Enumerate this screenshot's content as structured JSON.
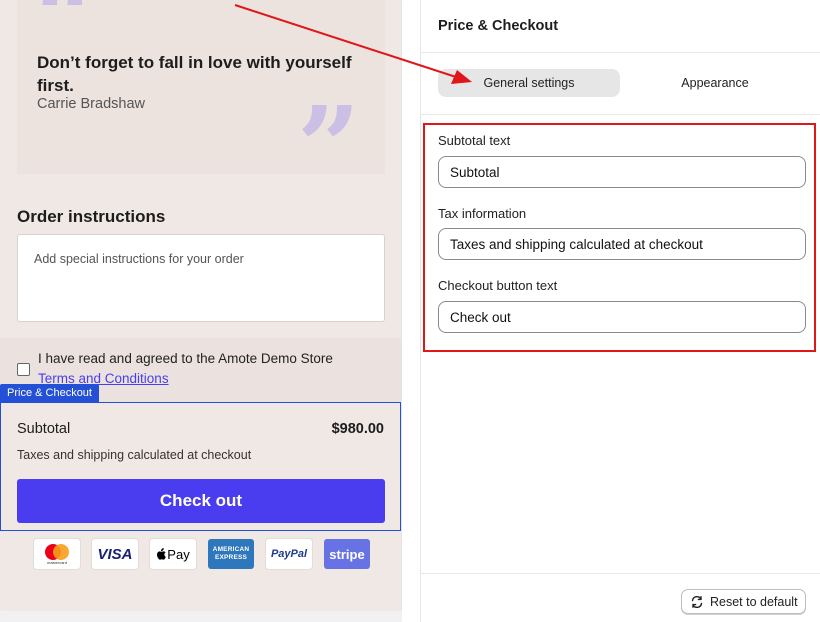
{
  "preview": {
    "quote": {
      "open_mark": "“",
      "close_mark": "”",
      "text": "Don’t forget to fall in love with yourself first.",
      "author": "Carrie Bradshaw"
    },
    "order_instructions": {
      "title": "Order instructions",
      "placeholder": "Add special instructions for your order"
    },
    "terms": {
      "text": "I have read and agreed to the Amote Demo Store",
      "link": "Terms and Conditions",
      "checked": false
    },
    "section_tag": "Price & Checkout",
    "checkout": {
      "subtotal_label": "Subtotal",
      "subtotal_amount": "$980.00",
      "tax_note": "Taxes and shipping calculated at checkout",
      "button_label": "Check out"
    },
    "payment_icons": [
      {
        "name": "mastercard-icon",
        "label": "mastercard"
      },
      {
        "name": "visa-icon",
        "label": "VISA"
      },
      {
        "name": "apple-pay-icon",
        "label": "Pay"
      },
      {
        "name": "american-express-icon",
        "label": "AMERICAN EXPRESS"
      },
      {
        "name": "paypal-icon",
        "label": "PayPal"
      },
      {
        "name": "stripe-icon",
        "label": "stripe"
      }
    ]
  },
  "panel": {
    "title": "Price & Checkout",
    "tabs": [
      {
        "label": "General settings",
        "active": true
      },
      {
        "label": "Appearance",
        "active": false
      }
    ],
    "fields": [
      {
        "label": "Subtotal text",
        "value": "Subtotal"
      },
      {
        "label": "Tax information",
        "value": "Taxes and shipping calculated at checkout"
      },
      {
        "label": "Checkout button text",
        "value": "Check out"
      }
    ],
    "reset_label": "Reset to default"
  },
  "colors": {
    "accent": "#4a3df0",
    "section_outline": "#2450d6",
    "annotation": "#e0161b",
    "drawer_bg": "#f0e8e5"
  }
}
